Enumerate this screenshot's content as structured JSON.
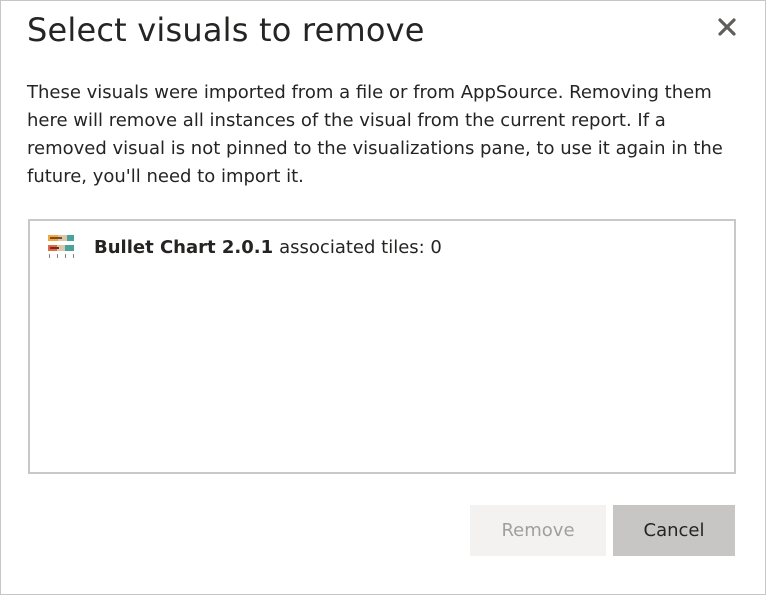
{
  "dialog": {
    "title": "Select visuals to remove",
    "description": "These visuals were imported from a file or from AppSource. Removing them here will remove all instances of the visual from the current report. If a removed visual is not pinned to the visualizations pane, to use it again in the future, you'll need to import it.",
    "close_icon": "close-icon"
  },
  "visuals": [
    {
      "icon": "bullet-chart-icon",
      "name": "Bullet Chart 2.0.1",
      "meta": "associated tiles: 0"
    }
  ],
  "buttons": {
    "remove_label": "Remove",
    "remove_disabled": true,
    "cancel_label": "Cancel"
  },
  "colors": {
    "title_text": "#252423",
    "remove_bg": "#f3f2f1",
    "remove_text": "#a19f9d",
    "cancel_bg": "#c8c6c4",
    "list_border": "#c8c8c8"
  }
}
